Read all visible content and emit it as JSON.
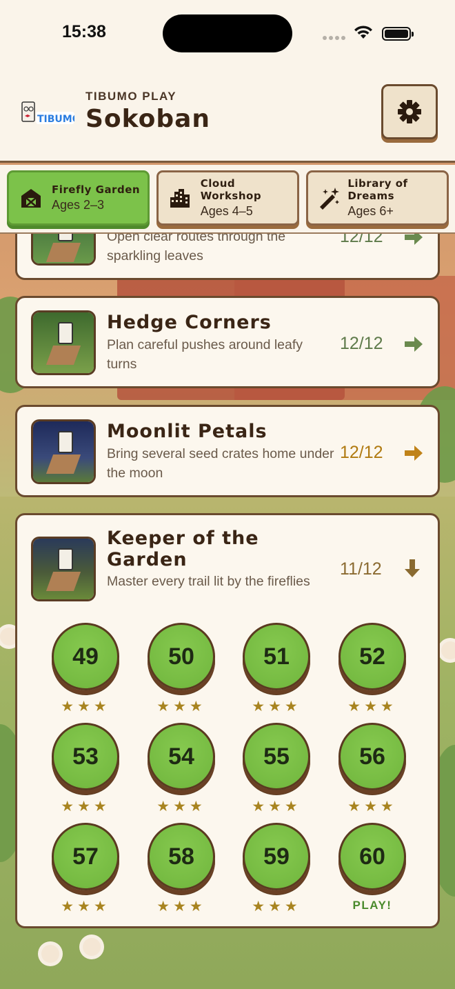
{
  "status_bar": {
    "time": "15:38"
  },
  "header": {
    "brand_sub": "TIBUMO PLAY",
    "title": "Sokoban",
    "logo_text": "TIBUMO",
    "settings_icon": "gear-icon"
  },
  "tabs": [
    {
      "name": "Firefly Garden",
      "ages": "Ages 2–3",
      "icon": "barn-icon",
      "active": true
    },
    {
      "name": "Cloud Workshop",
      "ages": "Ages 4–5",
      "icon": "buildings-icon",
      "active": false
    },
    {
      "name": "Library of Dreams",
      "ages": "Ages 6+",
      "icon": "magic-wand-icon",
      "active": false
    }
  ],
  "worlds": [
    {
      "title": "",
      "desc": "Open clear routes through the sparkling leaves",
      "progress": "12/12",
      "progress_color": "#5e7a4a",
      "icon": "arrow-right-icon"
    },
    {
      "title": "Hedge Corners",
      "desc": "Plan careful pushes around leafy turns",
      "progress": "12/12",
      "progress_color": "#5e7a4a",
      "icon": "arrow-right-icon"
    },
    {
      "title": "Moonlit Petals",
      "desc": "Bring several seed crates home under the moon",
      "progress": "12/12",
      "progress_color": "#b07a10",
      "icon": "arrow-right-icon"
    },
    {
      "title": "Keeper of the Garden",
      "desc": "Master every trail lit by the fireflies",
      "progress": "11/12",
      "progress_color": "#8a6a30",
      "icon": "arrow-down-icon"
    }
  ],
  "levels": [
    {
      "num": "49",
      "stars": "★★★"
    },
    {
      "num": "50",
      "stars": "★★★"
    },
    {
      "num": "51",
      "stars": "★★★"
    },
    {
      "num": "52",
      "stars": "★★★"
    },
    {
      "num": "53",
      "stars": "★★★"
    },
    {
      "num": "54",
      "stars": "★★★"
    },
    {
      "num": "55",
      "stars": "★★★"
    },
    {
      "num": "56",
      "stars": "★★★"
    },
    {
      "num": "57",
      "stars": "★★★"
    },
    {
      "num": "58",
      "stars": "★★★"
    },
    {
      "num": "59",
      "stars": "★★★"
    },
    {
      "num": "60",
      "play": "PLAY!"
    }
  ]
}
